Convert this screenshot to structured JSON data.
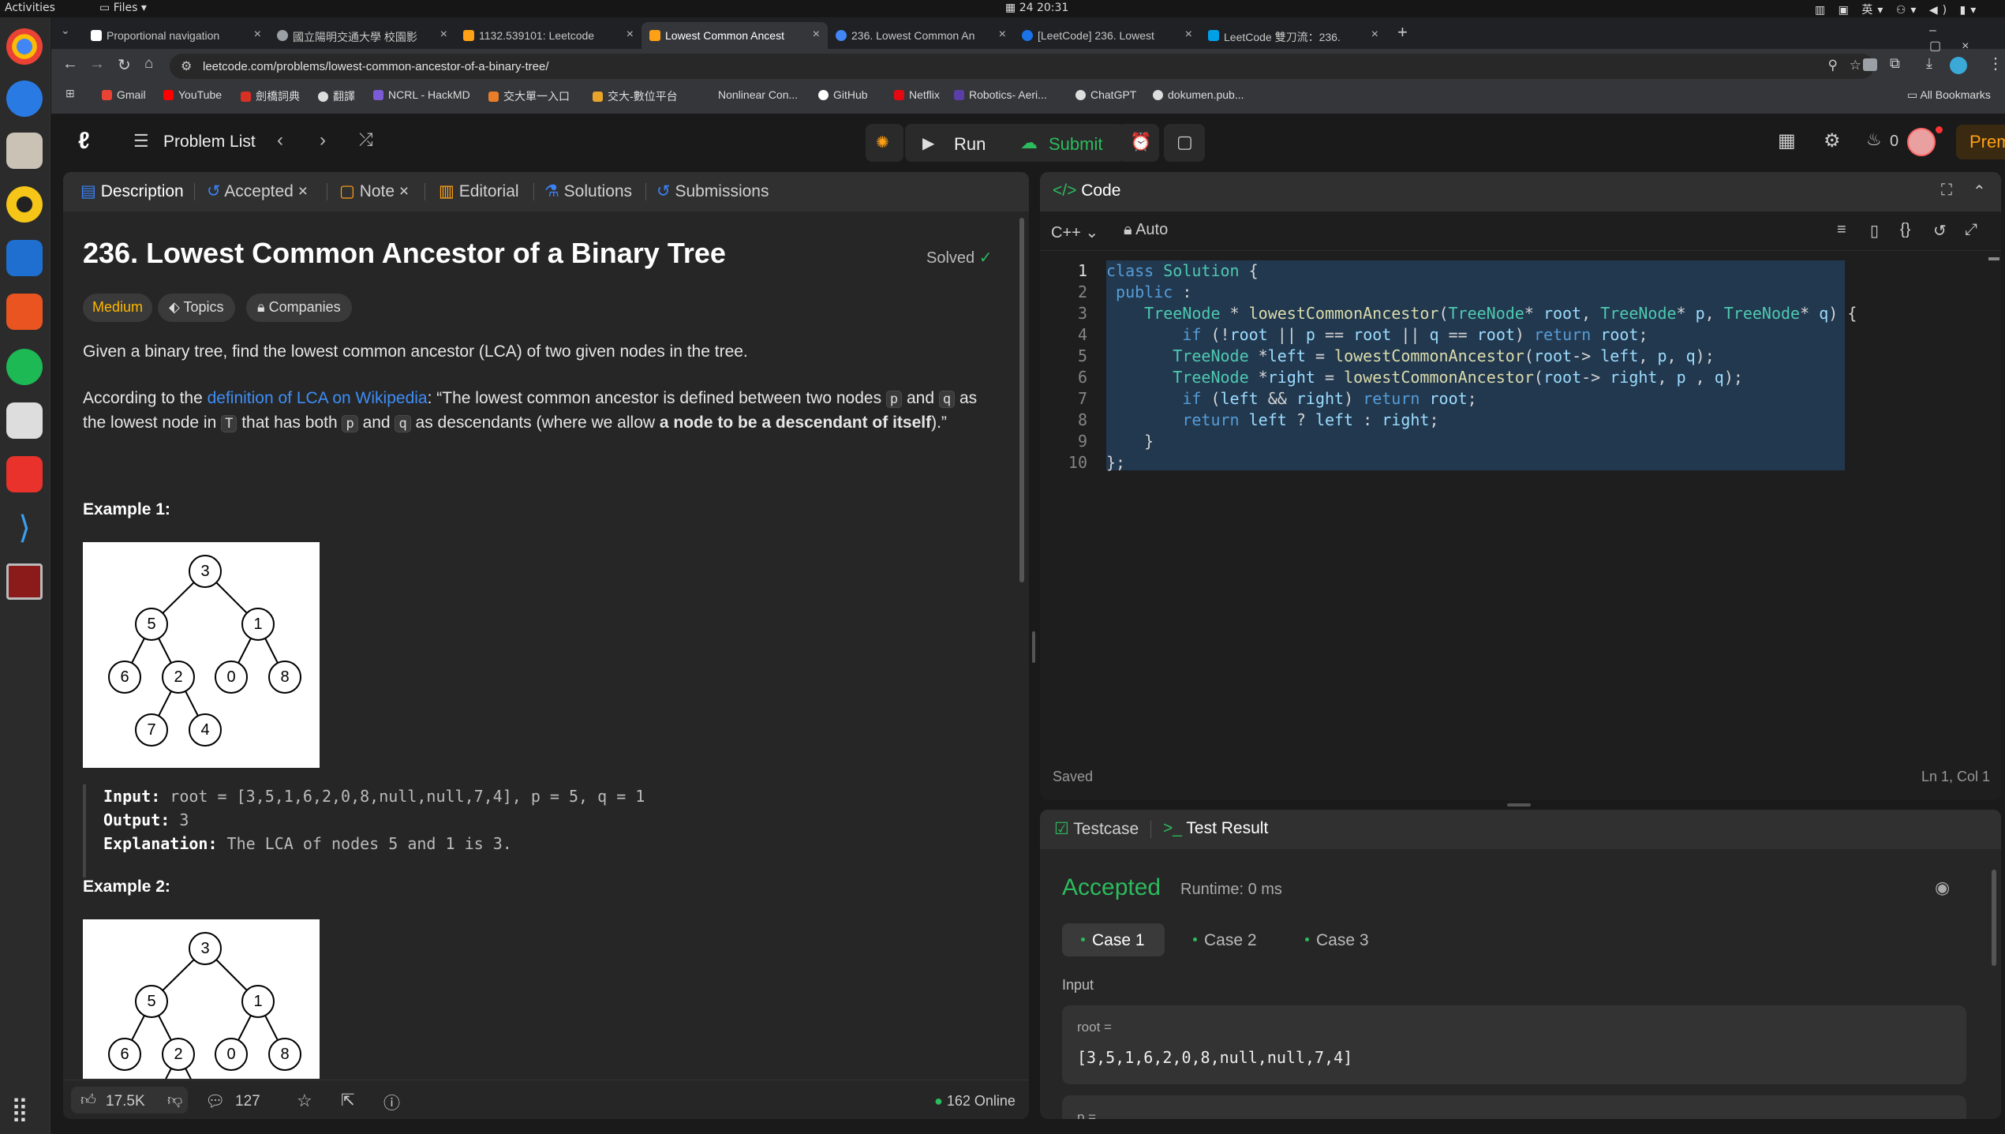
{
  "system": {
    "activities": "Activities",
    "files_menu": "Files",
    "clock": "24 20:31",
    "input_method": "英"
  },
  "browser": {
    "tabs": [
      {
        "label": "Proportional navigation",
        "icon": "wikipedia-icon"
      },
      {
        "label": "國立陽明交通大學 校園影",
        "icon": "globe-icon"
      },
      {
        "label": "1132.539101: Leetcode",
        "icon": "leetcode-icon"
      },
      {
        "label": "Lowest Common Ancest",
        "icon": "leetcode-icon",
        "active": true
      },
      {
        "label": "236. Lowest Common An",
        "icon": "google-icon"
      },
      {
        "label": "[LeetCode] 236. Lowest",
        "icon": "globe-icon"
      },
      {
        "label": "LeetCode 雙刀流：236.",
        "icon": "blog-icon"
      }
    ],
    "url": "leetcode.com/problems/lowest-common-ancestor-of-a-binary-tree/",
    "bookmarks": [
      "Gmail",
      "YouTube",
      "劍橋詞典",
      "翻譯",
      "NCRL - HackMD",
      "交大單一入口",
      "交大-數位平台",
      "Nonlinear Con...",
      "GitHub",
      "Netflix",
      "Robotics- Aeri...",
      "ChatGPT",
      "dokumen.pub..."
    ],
    "all_bookmarks": "All Bookmarks"
  },
  "nav": {
    "problem_list": "Problem List",
    "run": "Run",
    "submit": "Submit",
    "streak": "0",
    "premium": "Premium"
  },
  "desc_tabs": {
    "description": "Description",
    "accepted": "Accepted",
    "note": "Note",
    "editorial": "Editorial",
    "solutions": "Solutions",
    "submissions": "Submissions"
  },
  "problem": {
    "title": "236. Lowest Common Ancestor of a Binary Tree",
    "solved": "Solved",
    "difficulty": "Medium",
    "topics": "Topics",
    "companies": "Companies",
    "intro": "Given a binary tree, find the lowest common ancestor (LCA) of two given nodes in the tree.",
    "p2_a": "According to the ",
    "p2_link": "definition of LCA on Wikipedia",
    "p2_b": ": “The lowest common ancestor is defined between two nodes ",
    "p2_p": "p",
    "p2_and": " and ",
    "p2_q": "q",
    "p2_c": " as",
    "p3_a": "the lowest node in ",
    "p3_T": "T",
    "p3_b": " that has both ",
    "p3_p": "p",
    "p3_and": " and ",
    "p3_q": "q",
    "p3_c": " as descendants (where we allow ",
    "p3_bold": "a node to be a descendant of itself",
    "p3_d": ").”",
    "example1": "Example 1:",
    "ex1_input_label": "Input:",
    "ex1_input": " root = [3,5,1,6,2,0,8,null,null,7,4], p = 5, q = 1",
    "ex1_output_label": "Output:",
    "ex1_output": " 3",
    "ex1_expl_label": "Explanation:",
    "ex1_expl": " The LCA of nodes 5 and 1 is 3.",
    "example2": "Example 2:",
    "tree1_nodes": [
      "3",
      "5",
      "1",
      "6",
      "2",
      "0",
      "8",
      "7",
      "4"
    ],
    "tree2_nodes": [
      "3",
      "5",
      "1",
      "6",
      "2",
      "0",
      "8"
    ]
  },
  "footer": {
    "likes": "17.5K",
    "comments": "127",
    "online": "162 Online"
  },
  "code": {
    "header": "Code",
    "language": "C++",
    "auto": "Auto",
    "saved": "Saved",
    "cursor": "Ln 1, Col 1",
    "line_numbers": [
      "1",
      "2",
      "3",
      "4",
      "5",
      "6",
      "7",
      "8",
      "9",
      "10"
    ]
  },
  "result": {
    "testcase_tab": "Testcase",
    "result_tab": "Test Result",
    "status": "Accepted",
    "runtime": "Runtime: 0 ms",
    "cases": [
      "Case 1",
      "Case 2",
      "Case 3"
    ],
    "input_label": "Input",
    "root_label": "root =",
    "root_value": "[3,5,1,6,2,0,8,null,null,7,4]",
    "p_label": "p ="
  }
}
